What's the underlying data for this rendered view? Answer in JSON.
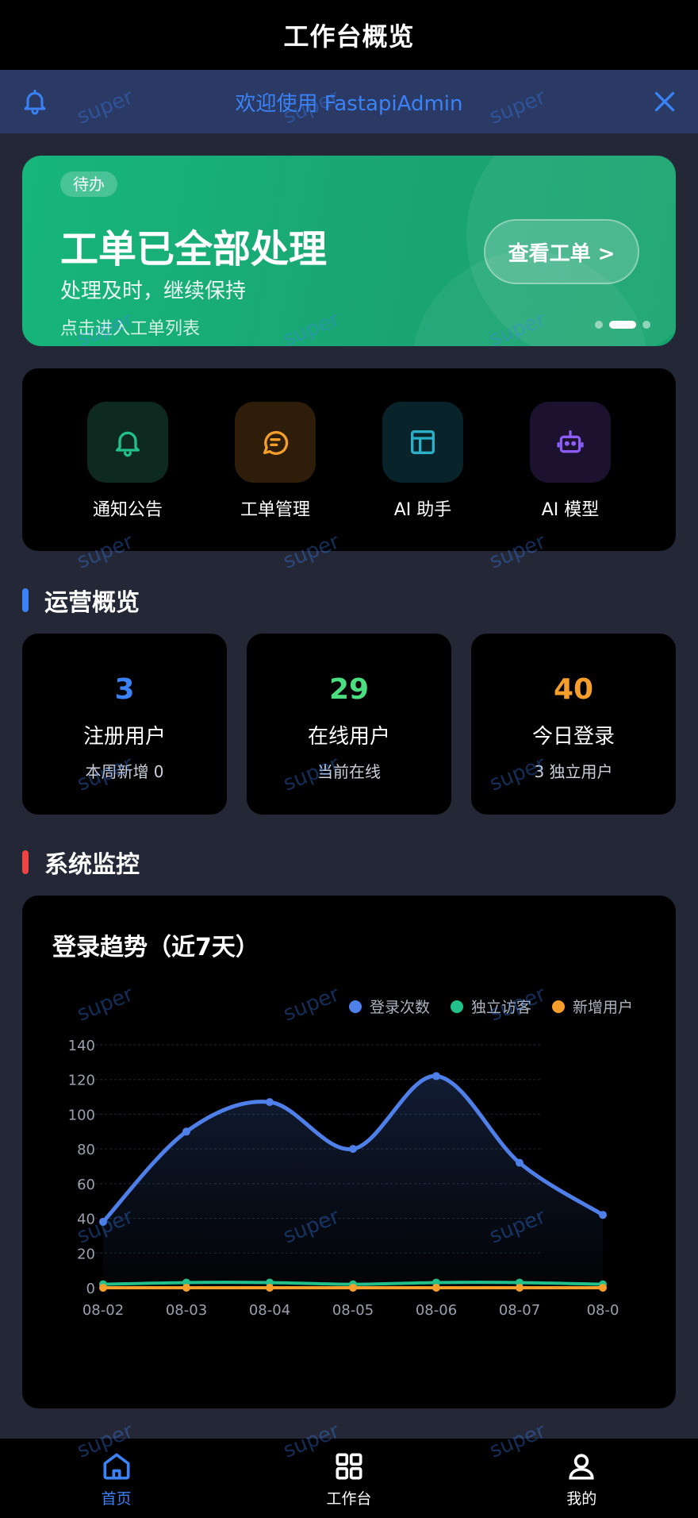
{
  "header": {
    "title": "工作台概览"
  },
  "notice": {
    "text": "欢迎使用 FastapiAdmin"
  },
  "banner": {
    "tag": "待办",
    "title": "工单已全部处理",
    "subtitle": "处理及时，继续保持",
    "hint": "点击进入工单列表",
    "cta": "查看工单 >"
  },
  "quick": {
    "items": [
      {
        "label": "通知公告",
        "icon": "bell-icon",
        "color": "#22c08a"
      },
      {
        "label": "工单管理",
        "icon": "message-icon",
        "color": "#f59e2b"
      },
      {
        "label": "AI 助手",
        "icon": "layout-icon",
        "color": "#2bb0c8"
      },
      {
        "label": "AI 模型",
        "icon": "robot-icon",
        "color": "#8b5cf6"
      }
    ]
  },
  "ops": {
    "title": "运营概览",
    "cards": [
      {
        "value": "3",
        "name": "注册用户",
        "desc": "本周新增 0",
        "color": "#3b82f6"
      },
      {
        "value": "29",
        "name": "在线用户",
        "desc": "当前在线",
        "color": "#4ade80"
      },
      {
        "value": "40",
        "name": "今日登录",
        "desc": "3 独立用户",
        "color": "#f59e2b"
      }
    ]
  },
  "monitor": {
    "title": "系统监控"
  },
  "chart": {
    "title": "登录趋势（近7天）"
  },
  "chart_data": {
    "type": "line",
    "title": "登录趋势（近7天）",
    "categories": [
      "08-02",
      "08-03",
      "08-04",
      "08-05",
      "08-06",
      "08-07",
      "08-0"
    ],
    "series": [
      {
        "name": "登录次数",
        "color": "#4f7fe8",
        "values": [
          38,
          90,
          107,
          80,
          122,
          72,
          42
        ]
      },
      {
        "name": "独立访客",
        "color": "#22c08a",
        "values": [
          2,
          3,
          3,
          2,
          3,
          3,
          2
        ]
      },
      {
        "name": "新增用户",
        "color": "#f59e2b",
        "values": [
          0,
          0,
          0,
          0,
          0,
          0,
          0
        ]
      }
    ],
    "ylim": [
      0,
      140
    ],
    "yticks": [
      0,
      20,
      40,
      60,
      80,
      100,
      120,
      140
    ],
    "grid": true,
    "legend": "top-right",
    "xlabel": "",
    "ylabel": ""
  },
  "tabbar": {
    "items": [
      {
        "label": "首页",
        "icon": "home-icon",
        "active": true
      },
      {
        "label": "工作台",
        "icon": "grid-icon",
        "active": false
      },
      {
        "label": "我的",
        "icon": "user-icon",
        "active": false
      }
    ]
  },
  "watermark": "super",
  "colors": {
    "accent": "#3b82f6",
    "background": "#242836",
    "card": "#000000"
  }
}
